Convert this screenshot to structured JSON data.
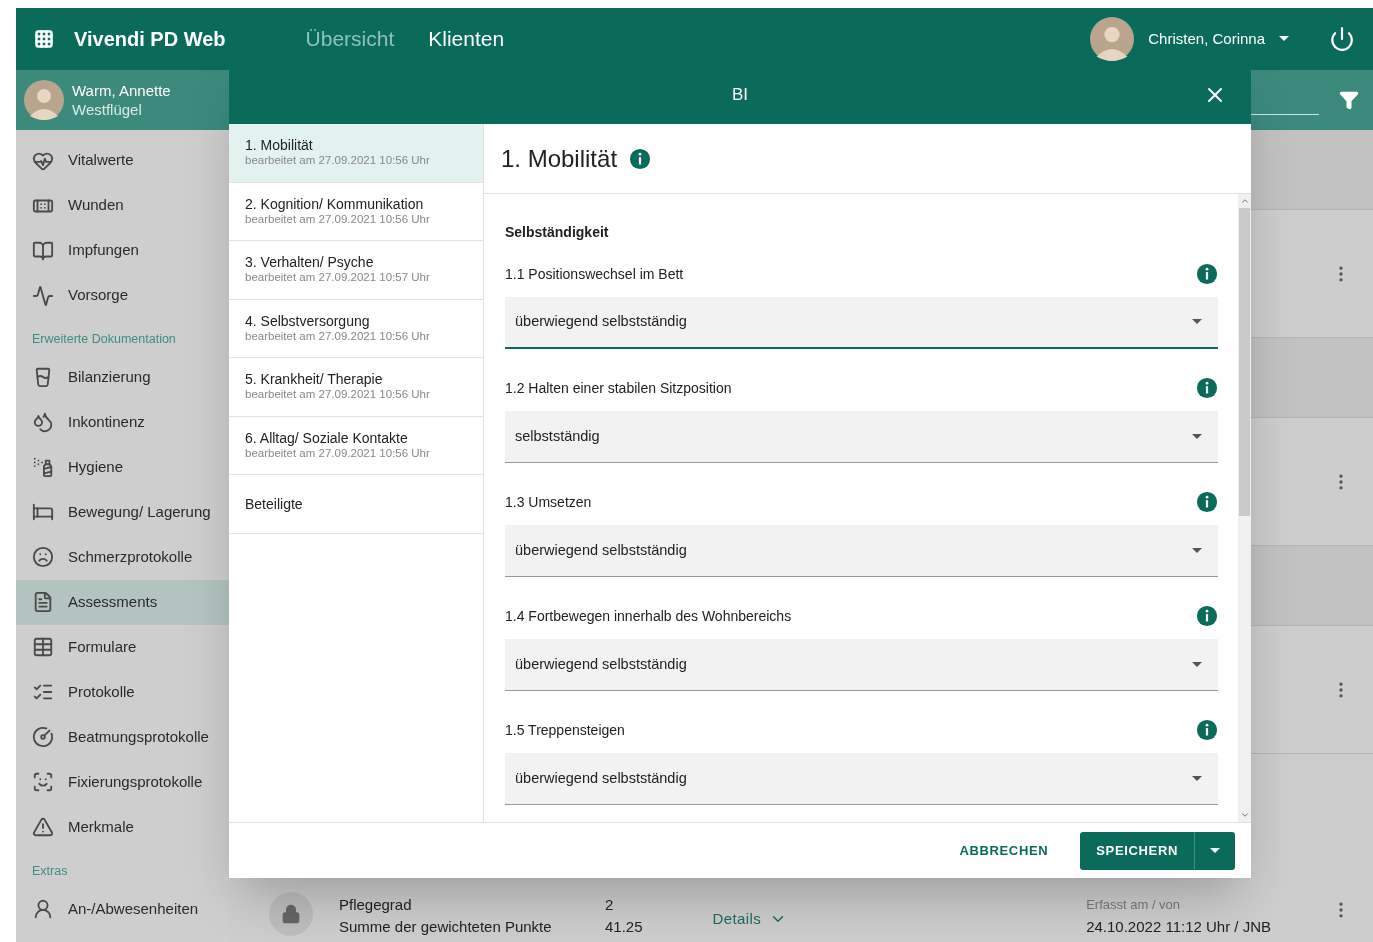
{
  "app": {
    "title": "Vivendi PD Web"
  },
  "nav": [
    {
      "label": "Übersicht",
      "selected": false
    },
    {
      "label": "Klienten",
      "selected": true
    }
  ],
  "user": {
    "name": "Christen, Corinna"
  },
  "client": {
    "name": "Warm, Annette",
    "unit": "Westflügel"
  },
  "sidebar": [
    {
      "items": [
        {
          "label": "Vitalwerte",
          "selected": false
        },
        {
          "label": "Wunden",
          "selected": false
        },
        {
          "label": "Impfungen",
          "selected": false
        },
        {
          "label": "Vorsorge",
          "selected": false
        }
      ]
    },
    {
      "heading": "Erweiterte Dokumentation",
      "items": [
        {
          "label": "Bilanzierung",
          "selected": false
        },
        {
          "label": "Inkontinenz",
          "selected": false
        },
        {
          "label": "Hygiene",
          "selected": false
        },
        {
          "label": "Bewegung/ Lagerung",
          "selected": false
        },
        {
          "label": "Schmerzprotokolle",
          "selected": false
        },
        {
          "label": "Assessments",
          "selected": true
        },
        {
          "label": "Formulare",
          "selected": false
        },
        {
          "label": "Protokolle",
          "selected": false
        },
        {
          "label": "Beatmungsprotokolle",
          "selected": false
        },
        {
          "label": "Fixierungsprotokolle",
          "selected": false
        },
        {
          "label": "Merkmale",
          "selected": false
        }
      ]
    },
    {
      "heading": "Extras",
      "items": [
        {
          "label": "An-/Abwesenheiten",
          "selected": false
        }
      ]
    }
  ],
  "record": {
    "fields": [
      {
        "label": "Pflegegrad",
        "value": "2"
      },
      {
        "label": "Summe der gewichteten Punkte",
        "value": "41.25"
      }
    ],
    "details": "Details",
    "meta_label": "Erfasst am / von",
    "meta_value": "24.10.2022 11:12 Uhr / JNB"
  },
  "dialog": {
    "title": "BI",
    "sections": [
      {
        "title": "1. Mobilität",
        "edited": "bearbeitet am 27.09.2021 10:56 Uhr",
        "selected": true
      },
      {
        "title": "2. Kognition/ Kommunikation",
        "edited": "bearbeitet am 27.09.2021 10:56 Uhr",
        "selected": false
      },
      {
        "title": "3. Verhalten/ Psyche",
        "edited": "bearbeitet am 27.09.2021 10:57 Uhr",
        "selected": false
      },
      {
        "title": "4. Selbstversorgung",
        "edited": "bearbeitet am 27.09.2021 10:56 Uhr",
        "selected": false
      },
      {
        "title": "5. Krankheit/ Therapie",
        "edited": "bearbeitet am 27.09.2021 10:56 Uhr",
        "selected": false
      },
      {
        "title": "6. Alltag/ Soziale Kontakte",
        "edited": "bearbeitet am 27.09.2021 10:56 Uhr",
        "selected": false
      },
      {
        "title": "Beteiligte",
        "selected": false
      }
    ],
    "heading": "1. Mobilität",
    "group": "Selbständigkeit",
    "questions": [
      {
        "label": "1.1 Positionswechsel im Bett",
        "value": "überwiegend selbstständig",
        "focused": true
      },
      {
        "label": "1.2 Halten einer stabilen Sitzposition",
        "value": "selbstständig",
        "focused": false
      },
      {
        "label": "1.3 Umsetzen",
        "value": "überwiegend selbstständig",
        "focused": false
      },
      {
        "label": "1.4 Fortbewegen innerhalb des Wohnbereichs",
        "value": "überwiegend selbstständig",
        "focused": false
      },
      {
        "label": "1.5 Treppensteigen",
        "value": "überwiegend selbstständig",
        "focused": false
      }
    ],
    "cancel": "ABBRECHEN",
    "save": "SPEICHERN"
  }
}
